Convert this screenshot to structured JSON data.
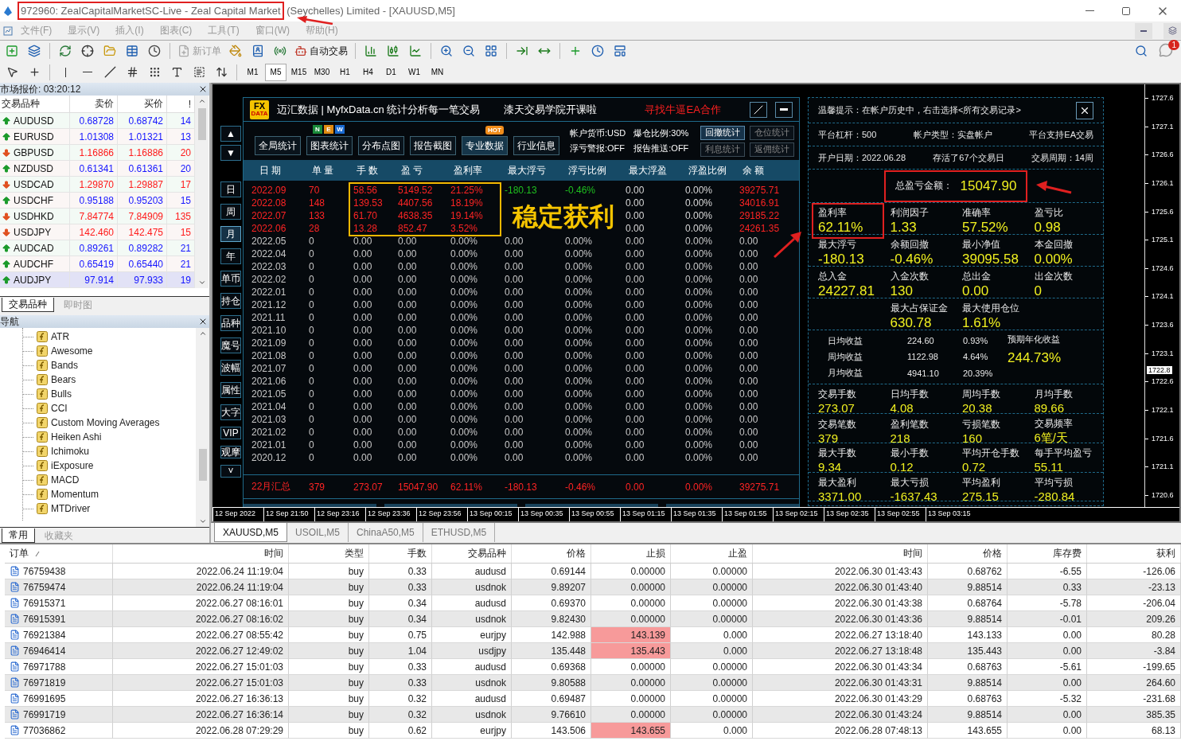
{
  "window": {
    "title_marked_part": "972960: ZealCapitalMarketSC-Live - Zeal Capital Market",
    "title_rest": " (Seychelles) Limited - [XAUUSD,M5]"
  },
  "menu": [
    "文件(F)",
    "显示(V)",
    "插入(I)",
    "图表(C)",
    "工具(T)",
    "窗口(W)",
    "帮助(H)"
  ],
  "toolbar": {
    "buttons": [
      {
        "label": "新订单",
        "disabled": true
      },
      {
        "label": "自动交易",
        "disabled": false
      }
    ],
    "timeframes": [
      {
        "label": "M1",
        "selected": false
      },
      {
        "label": "M5",
        "selected": true
      },
      {
        "label": "M15",
        "selected": false
      },
      {
        "label": "M30",
        "selected": false
      },
      {
        "label": "H1",
        "selected": false
      },
      {
        "label": "H4",
        "selected": false
      },
      {
        "label": "D1",
        "selected": false
      },
      {
        "label": "W1",
        "selected": false
      },
      {
        "label": "MN",
        "selected": false
      }
    ],
    "notification_badge": "1"
  },
  "market_watch": {
    "title": "市场报价: 03:20:12",
    "columns": [
      "交易品种",
      "卖价",
      "买价",
      "!"
    ],
    "rows": [
      {
        "symbol": "AUDUSD",
        "bid": "0.68728",
        "ask": "0.68742",
        "spread": "14",
        "rising": true,
        "selected": false
      },
      {
        "symbol": "EURUSD",
        "bid": "1.01308",
        "ask": "1.01321",
        "spread": "13",
        "rising": true,
        "selected": false
      },
      {
        "symbol": "GBPUSD",
        "bid": "1.16866",
        "ask": "1.16886",
        "spread": "20",
        "rising": false,
        "selected": false
      },
      {
        "symbol": "NZDUSD",
        "bid": "0.61341",
        "ask": "0.61361",
        "spread": "20",
        "rising": true,
        "selected": false
      },
      {
        "symbol": "USDCAD",
        "bid": "1.29870",
        "ask": "1.29887",
        "spread": "17",
        "rising": false,
        "selected": false
      },
      {
        "symbol": "USDCHF",
        "bid": "0.95188",
        "ask": "0.95203",
        "spread": "15",
        "rising": true,
        "selected": false
      },
      {
        "symbol": "USDHKD",
        "bid": "7.84774",
        "ask": "7.84909",
        "spread": "135",
        "rising": false,
        "selected": false
      },
      {
        "symbol": "USDJPY",
        "bid": "142.460",
        "ask": "142.475",
        "spread": "15",
        "rising": false,
        "selected": false
      },
      {
        "symbol": "AUDCAD",
        "bid": "0.89261",
        "ask": "0.89282",
        "spread": "21",
        "rising": true,
        "selected": false
      },
      {
        "symbol": "AUDCHF",
        "bid": "0.65419",
        "ask": "0.65440",
        "spread": "21",
        "rising": true,
        "selected": false
      },
      {
        "symbol": "AUDJPY",
        "bid": "97.914",
        "ask": "97.933",
        "spread": "19",
        "rising": true,
        "selected": true
      }
    ],
    "tabs": [
      {
        "label": "交易品种",
        "selected": true
      },
      {
        "label": "即时图",
        "selected": false
      }
    ]
  },
  "navigator": {
    "title": "导航",
    "items": [
      "ATR",
      "Awesome",
      "Bands",
      "Bears",
      "Bulls",
      "CCI",
      "Custom Moving Averages",
      "Heiken Ashi",
      "Ichimoku",
      "iExposure",
      "MACD",
      "Momentum",
      "MTDriver"
    ],
    "tabs": [
      {
        "label": "常用",
        "selected": true
      },
      {
        "label": "收藏夹",
        "selected": false
      }
    ]
  },
  "chart": {
    "stats_tool": {
      "logo": [
        "FX",
        "DATA"
      ],
      "header": [
        "迈汇数据 | MyfxData.cn  统计分析每一笔交易",
        "漆天交易学院开课啦",
        "寻找牛逼EA合作"
      ],
      "side_buttons": [
        {
          "label": "日",
          "selected": false
        },
        {
          "label": "周",
          "selected": false
        },
        {
          "label": "月",
          "selected": true
        },
        {
          "label": "年",
          "selected": false
        },
        {
          "label": "单币",
          "selected": false
        },
        {
          "label": "持仓",
          "selected": false
        },
        {
          "label": "品种",
          "selected": false
        },
        {
          "label": "魔号",
          "selected": false
        },
        {
          "label": "波幅",
          "selected": false
        },
        {
          "label": "属性",
          "selected": false
        },
        {
          "label": "大字",
          "selected": false
        },
        {
          "label": "VIP",
          "selected": false
        },
        {
          "label": "观摩",
          "selected": false
        },
        {
          "label": "˅",
          "selected": false
        }
      ],
      "scroll_buttons": [
        "▲",
        "▼"
      ],
      "nav_buttons": [
        {
          "label": "全局统计",
          "selected": false
        },
        {
          "label": "图表统计",
          "selected": false,
          "badge": [
            "N",
            "E",
            "W"
          ]
        },
        {
          "label": "分布点图",
          "selected": false
        },
        {
          "label": "报告截图",
          "selected": false
        },
        {
          "label": "专业数据",
          "selected": true,
          "badge": [
            "HOT"
          ]
        },
        {
          "label": "行业信息",
          "selected": false
        }
      ],
      "settings": [
        "帐户货币:USD",
        "爆仓比例:30%",
        "浮亏警报:OFF",
        "报告推送:OFF"
      ],
      "stat_buttons": [
        {
          "label": "回撤统计",
          "active": true
        },
        {
          "label": "仓位统计",
          "active": false
        },
        {
          "label": "利息统计",
          "active": false
        },
        {
          "label": "返佣统计",
          "active": false
        }
      ],
      "columns": [
        "日 期",
        "单 量",
        "手 数",
        "盈 亏",
        "盈利率",
        "最大浮亏",
        "浮亏比例",
        "最大浮盈",
        "浮盈比例",
        "余 额"
      ],
      "rows": [
        {
          "cells": [
            "2022.09",
            "70",
            "58.56",
            "5149.52",
            "21.25%",
            "-180.13",
            "-0.46%",
            "0.00",
            "0.00%",
            "39275.71"
          ],
          "traded": true,
          "drawdown": true
        },
        {
          "cells": [
            "2022.08",
            "148",
            "139.53",
            "4407.56",
            "18.19%",
            null,
            null,
            "0.00",
            "0.00%",
            "34016.91"
          ],
          "traded": true,
          "drawdown": false
        },
        {
          "cells": [
            "2022.07",
            "133",
            "61.70",
            "4638.35",
            "19.14%",
            null,
            null,
            "0.00",
            "0.00%",
            "29185.22"
          ],
          "traded": true,
          "drawdown": false
        },
        {
          "cells": [
            "2022.06",
            "28",
            "13.28",
            "852.47",
            "3.52%",
            null,
            null,
            "0.00",
            "0.00%",
            "24261.35"
          ],
          "traded": true,
          "drawdown": false
        },
        {
          "cells": [
            "2022.05",
            "0",
            "0.00",
            "0.00",
            "0.00%",
            "0.00",
            "0.00%",
            "0.00",
            "0.00%",
            "0.00"
          ],
          "traded": false,
          "drawdown": false
        },
        {
          "cells": [
            "2022.04",
            "0",
            "0.00",
            "0.00",
            "0.00%",
            "0.00",
            "0.00%",
            "0.00",
            "0.00%",
            "0.00"
          ],
          "traded": false,
          "drawdown": false
        },
        {
          "cells": [
            "2022.03",
            "0",
            "0.00",
            "0.00",
            "0.00%",
            "0.00",
            "0.00%",
            "0.00",
            "0.00%",
            "0.00"
          ],
          "traded": false,
          "drawdown": false
        },
        {
          "cells": [
            "2022.02",
            "0",
            "0.00",
            "0.00",
            "0.00%",
            "0.00",
            "0.00%",
            "0.00",
            "0.00%",
            "0.00"
          ],
          "traded": false,
          "drawdown": false
        },
        {
          "cells": [
            "2022.01",
            "0",
            "0.00",
            "0.00",
            "0.00%",
            "0.00",
            "0.00%",
            "0.00",
            "0.00%",
            "0.00"
          ],
          "traded": false,
          "drawdown": false
        },
        {
          "cells": [
            "2021.12",
            "0",
            "0.00",
            "0.00",
            "0.00%",
            "0.00",
            "0.00%",
            "0.00",
            "0.00%",
            "0.00"
          ],
          "traded": false,
          "drawdown": false
        },
        {
          "cells": [
            "2021.11",
            "0",
            "0.00",
            "0.00",
            "0.00%",
            "0.00",
            "0.00%",
            "0.00",
            "0.00%",
            "0.00"
          ],
          "traded": false,
          "drawdown": false
        },
        {
          "cells": [
            "2021.10",
            "0",
            "0.00",
            "0.00",
            "0.00%",
            "0.00",
            "0.00%",
            "0.00",
            "0.00%",
            "0.00"
          ],
          "traded": false,
          "drawdown": false
        },
        {
          "cells": [
            "2021.09",
            "0",
            "0.00",
            "0.00",
            "0.00%",
            "0.00",
            "0.00%",
            "0.00",
            "0.00%",
            "0.00"
          ],
          "traded": false,
          "drawdown": false
        },
        {
          "cells": [
            "2021.08",
            "0",
            "0.00",
            "0.00",
            "0.00%",
            "0.00",
            "0.00%",
            "0.00",
            "0.00%",
            "0.00"
          ],
          "traded": false,
          "drawdown": false
        },
        {
          "cells": [
            "2021.07",
            "0",
            "0.00",
            "0.00",
            "0.00%",
            "0.00",
            "0.00%",
            "0.00",
            "0.00%",
            "0.00"
          ],
          "traded": false,
          "drawdown": false
        },
        {
          "cells": [
            "2021.06",
            "0",
            "0.00",
            "0.00",
            "0.00%",
            "0.00",
            "0.00%",
            "0.00",
            "0.00%",
            "0.00"
          ],
          "traded": false,
          "drawdown": false
        },
        {
          "cells": [
            "2021.05",
            "0",
            "0.00",
            "0.00",
            "0.00%",
            "0.00",
            "0.00%",
            "0.00",
            "0.00%",
            "0.00"
          ],
          "traded": false,
          "drawdown": false
        },
        {
          "cells": [
            "2021.04",
            "0",
            "0.00",
            "0.00",
            "0.00%",
            "0.00",
            "0.00%",
            "0.00",
            "0.00%",
            "0.00"
          ],
          "traded": false,
          "drawdown": false
        },
        {
          "cells": [
            "2021.03",
            "0",
            "0.00",
            "0.00",
            "0.00%",
            "0.00",
            "0.00%",
            "0.00",
            "0.00%",
            "0.00"
          ],
          "traded": false,
          "drawdown": false
        },
        {
          "cells": [
            "2021.02",
            "0",
            "0.00",
            "0.00",
            "0.00%",
            "0.00",
            "0.00%",
            "0.00",
            "0.00%",
            "0.00"
          ],
          "traded": false,
          "drawdown": false
        },
        {
          "cells": [
            "2021.01",
            "0",
            "0.00",
            "0.00",
            "0.00%",
            "0.00",
            "0.00%",
            "0.00",
            "0.00%",
            "0.00"
          ],
          "traded": false,
          "drawdown": false
        },
        {
          "cells": [
            "2020.12",
            "0",
            "0.00",
            "0.00",
            "0.00%",
            "0.00",
            "0.00%",
            "0.00",
            "0.00%",
            "0.00"
          ],
          "traded": false,
          "drawdown": false
        }
      ],
      "summary": [
        "22月汇总",
        "379",
        "273.07",
        "15047.90",
        "62.11%",
        "-180.13",
        "-0.46%",
        "0.00",
        "0.00%",
        "39275.71"
      ],
      "caption": "稳定获利"
    },
    "stats_panel": {
      "notice": "温馨提示：在帐户历史中，右击选择<所有交易记录>",
      "info_rows": [
        [
          "平台杠杆：500",
          "帐户类型：实盘帐户",
          "平台支持EA交易"
        ],
        [
          "开户日期：2022.06.28",
          "存活了67个交易日",
          "交易周期：14周"
        ]
      ],
      "total": {
        "label": "总盈亏金额：",
        "value": "15047.90",
        "marked": true
      },
      "large_groups": [
        {
          "items": [
            {
              "label": "盈利率",
              "value": "62.11%",
              "marked": true
            },
            {
              "label": "利润因子",
              "value": "1.33",
              "marked": false
            },
            {
              "label": "准确率",
              "value": "57.52%",
              "marked": false
            },
            {
              "label": "盈亏比",
              "value": "0.98",
              "marked": false
            }
          ]
        },
        {
          "items": [
            {
              "label": "最大浮亏",
              "value": "-180.13"
            },
            {
              "label": "余额回撤",
              "value": "-0.46%"
            },
            {
              "label": "最小净值",
              "value": "39095.58"
            },
            {
              "label": "本金回撤",
              "value": "0.00%"
            }
          ]
        },
        {
          "items": [
            {
              "label": "总入金",
              "value": "24227.81"
            },
            {
              "label": "入金次数",
              "value": "130"
            },
            {
              "label": "总出金",
              "value": "0.00"
            },
            {
              "label": "出金次数",
              "value": "0"
            }
          ]
        },
        {
          "centered": true,
          "items": [
            {
              "label": "最大占保证金",
              "value": "630.78"
            },
            {
              "label": "最大使用仓位",
              "value": "1.61%"
            }
          ]
        }
      ],
      "averages": {
        "rows": [
          {
            "label": "日均收益",
            "amount": "224.60",
            "percent": "0.93%"
          },
          {
            "label": "周均收益",
            "amount": "1122.98",
            "percent": "4.64%"
          },
          {
            "label": "月均收益",
            "amount": "4941.10",
            "percent": "20.39%"
          }
        ],
        "annual_label": "预期年化收益",
        "annual_value": "244.73%"
      },
      "small_groups": [
        {
          "items": [
            {
              "label": "交易手数",
              "value": "273.07"
            },
            {
              "label": "日均手数",
              "value": "4.08"
            },
            {
              "label": "周均手数",
              "value": "20.38"
            },
            {
              "label": "月均手数",
              "value": "89.66"
            }
          ]
        },
        {
          "items": [
            {
              "label": "交易笔数",
              "value": "379"
            },
            {
              "label": "盈利笔数",
              "value": "218"
            },
            {
              "label": "亏损笔数",
              "value": "160"
            },
            {
              "label": "交易频率",
              "value": "6笔/天"
            }
          ]
        },
        {
          "items": [
            {
              "label": "最大手数",
              "value": "9.34"
            },
            {
              "label": "最小手数",
              "value": "0.12"
            },
            {
              "label": "平均开仓手数",
              "value": "0.72"
            },
            {
              "label": "每手平均盈亏",
              "value": "55.11"
            }
          ]
        },
        {
          "items": [
            {
              "label": "最大盈利",
              "value": "3371.00"
            },
            {
              "label": "最大亏损",
              "value": "-1637.43"
            },
            {
              "label": "平均盈利",
              "value": "275.15"
            },
            {
              "label": "平均亏损",
              "value": "-280.84"
            }
          ]
        }
      ]
    },
    "price_labels": [
      "1727.6",
      "1727.1",
      "1726.6",
      "1726.1",
      "1725.6",
      "1725.1",
      "1724.6",
      "1724.1",
      "1723.6",
      "1723.1",
      "1722.6",
      "1722.1",
      "1721.6",
      "1721.1",
      "1720.6"
    ],
    "current_price": "1722.8",
    "time_labels": [
      "12 Sep 2022",
      "12 Sep 21:50",
      "12 Sep 23:16",
      "12 Sep 23:36",
      "12 Sep 23:56",
      "13 Sep 00:15",
      "13 Sep 00:35",
      "13 Sep 00:55",
      "13 Sep 01:15",
      "13 Sep 01:35",
      "13 Sep 01:55",
      "13 Sep 02:15",
      "13 Sep 02:35",
      "13 Sep 02:55",
      "13 Sep 03:15"
    ],
    "tabs": [
      {
        "label": "XAUUSD,M5",
        "selected": true
      },
      {
        "label": "USOIL,M5",
        "selected": false
      },
      {
        "label": "ChinaA50,M5",
        "selected": false
      },
      {
        "label": "ETHUSD,M5",
        "selected": false
      }
    ]
  },
  "terminal": {
    "columns": [
      "订单",
      "时间",
      "类型",
      "手数",
      "交易品种",
      "价格",
      "止损",
      "止盈",
      "时间",
      "价格",
      "库存费",
      "获利"
    ],
    "rows": [
      {
        "cells": [
          "76759438",
          "2022.06.24 11:19:04",
          "buy",
          "0.33",
          "audusd",
          "0.69144",
          "0.00000",
          "0.00000",
          "2022.06.30 01:43:43",
          "0.68762",
          "-6.55",
          "-126.06"
        ],
        "stop_hit": false
      },
      {
        "cells": [
          "76759474",
          "2022.06.24 11:19:04",
          "buy",
          "0.33",
          "usdnok",
          "9.89207",
          "0.00000",
          "0.00000",
          "2022.06.30 01:43:40",
          "9.88514",
          "0.33",
          "-23.13"
        ],
        "stop_hit": false
      },
      {
        "cells": [
          "76915371",
          "2022.06.27 08:16:01",
          "buy",
          "0.34",
          "audusd",
          "0.69370",
          "0.00000",
          "0.00000",
          "2022.06.30 01:43:38",
          "0.68764",
          "-5.78",
          "-206.04"
        ],
        "stop_hit": false
      },
      {
        "cells": [
          "76915391",
          "2022.06.27 08:16:02",
          "buy",
          "0.34",
          "usdnok",
          "9.82430",
          "0.00000",
          "0.00000",
          "2022.06.30 01:43:36",
          "9.88514",
          "-0.01",
          "209.26"
        ],
        "stop_hit": false
      },
      {
        "cells": [
          "76921384",
          "2022.06.27 08:55:42",
          "buy",
          "0.75",
          "eurjpy",
          "142.988",
          "143.139",
          "0.000",
          "2022.06.27 13:18:40",
          "143.133",
          "0.00",
          "80.28"
        ],
        "stop_hit": true
      },
      {
        "cells": [
          "76946414",
          "2022.06.27 12:49:02",
          "buy",
          "1.04",
          "usdjpy",
          "135.448",
          "135.443",
          "0.000",
          "2022.06.27 13:18:48",
          "135.443",
          "0.00",
          "-3.84"
        ],
        "stop_hit": true
      },
      {
        "cells": [
          "76971788",
          "2022.06.27 15:01:03",
          "buy",
          "0.33",
          "audusd",
          "0.69368",
          "0.00000",
          "0.00000",
          "2022.06.30 01:43:34",
          "0.68763",
          "-5.61",
          "-199.65"
        ],
        "stop_hit": false
      },
      {
        "cells": [
          "76971819",
          "2022.06.27 15:01:03",
          "buy",
          "0.33",
          "usdnok",
          "9.80588",
          "0.00000",
          "0.00000",
          "2022.06.30 01:43:31",
          "9.88514",
          "0.00",
          "264.60"
        ],
        "stop_hit": false
      },
      {
        "cells": [
          "76991695",
          "2022.06.27 16:36:13",
          "buy",
          "0.32",
          "audusd",
          "0.69487",
          "0.00000",
          "0.00000",
          "2022.06.30 01:43:29",
          "0.68763",
          "-5.32",
          "-231.68"
        ],
        "stop_hit": false
      },
      {
        "cells": [
          "76991719",
          "2022.06.27 16:36:14",
          "buy",
          "0.32",
          "usdnok",
          "9.76610",
          "0.00000",
          "0.00000",
          "2022.06.30 01:43:24",
          "9.88514",
          "0.00",
          "385.35"
        ],
        "stop_hit": false
      },
      {
        "cells": [
          "77036862",
          "2022.06.28 07:29:29",
          "buy",
          "0.62",
          "eurjpy",
          "143.506",
          "143.655",
          "0.000",
          "2022.06.28 07:48:13",
          "143.655",
          "0.00",
          "68.13"
        ],
        "stop_hit": true
      }
    ]
  }
}
